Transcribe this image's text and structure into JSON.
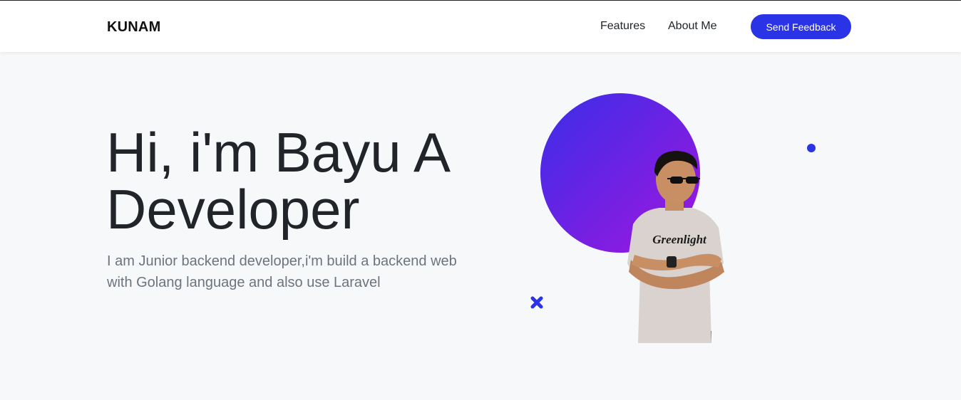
{
  "navbar": {
    "brand": "KUNAM",
    "links": [
      {
        "label": "Features"
      },
      {
        "label": "About Me"
      }
    ],
    "cta_label": "Send Feedback"
  },
  "hero": {
    "title_line1": "Hi, i'm Bayu A",
    "title_line2": "Developer",
    "description": "I am Junior backend developer,i'm build a backend web with Golang language and also use Laravel",
    "shirt_text": "Greenlight"
  },
  "colors": {
    "accent": "#2a33e6",
    "gradient_start": "#3a2ee8",
    "gradient_end": "#9a18e0",
    "background": "#f7f8fa"
  },
  "icons": [
    "dot-icon",
    "cross-icon"
  ]
}
